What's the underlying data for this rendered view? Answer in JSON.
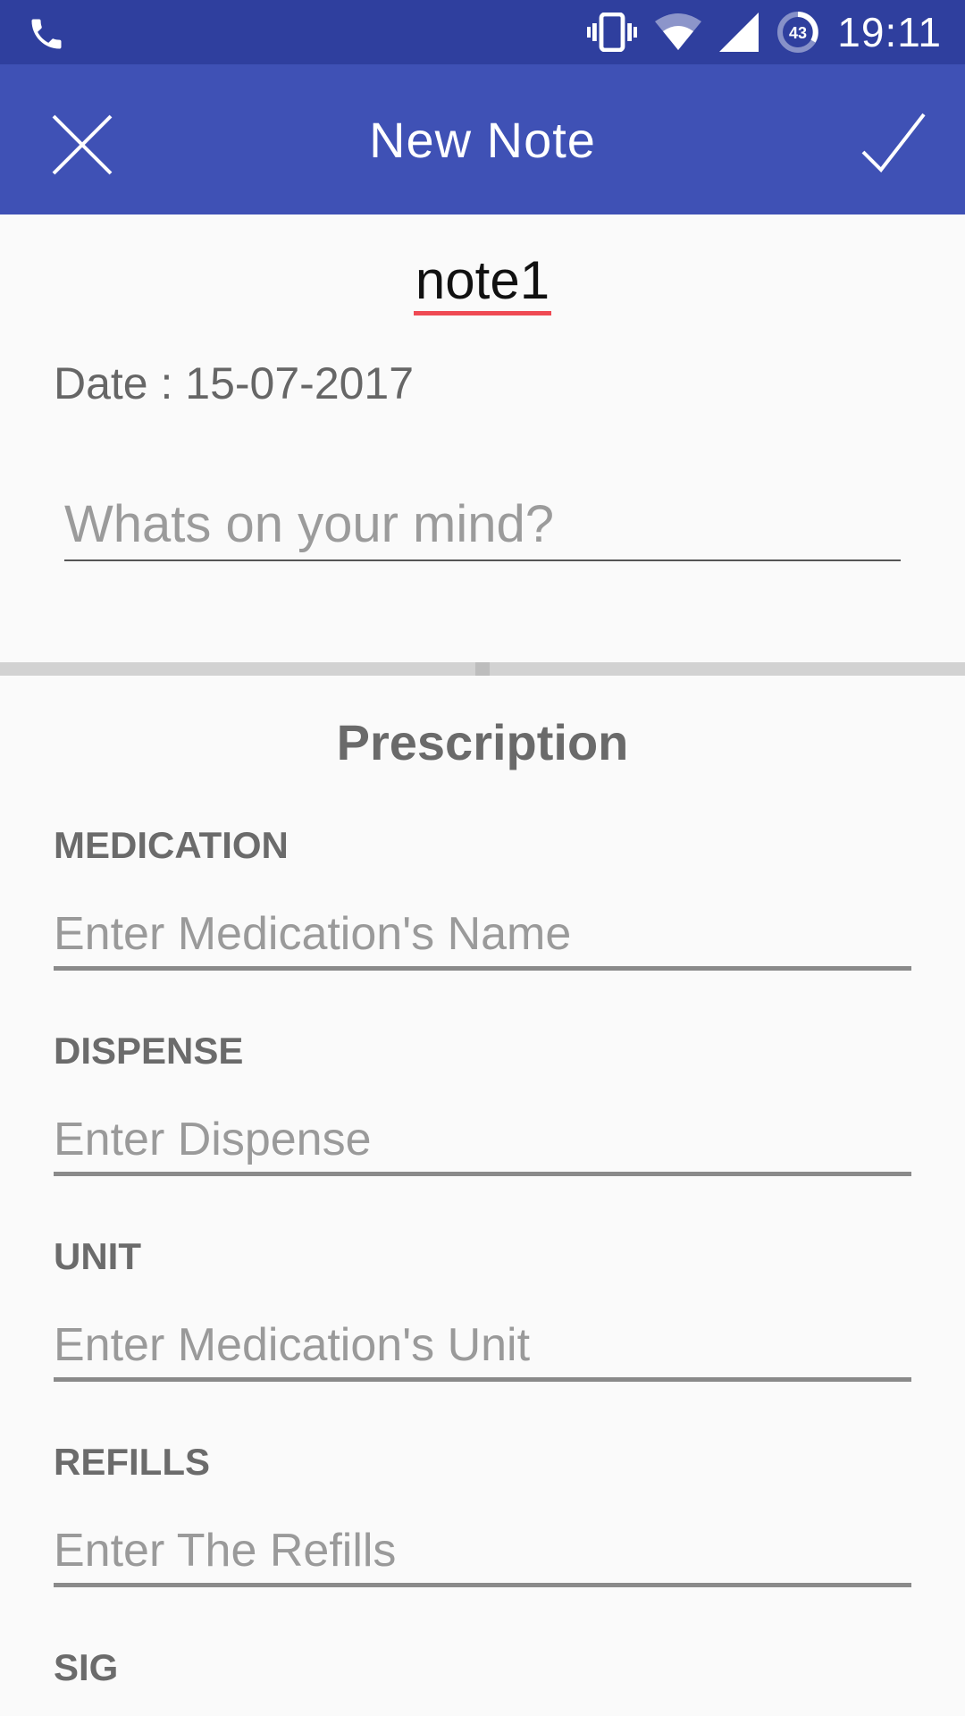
{
  "status_bar": {
    "time": "19:11",
    "battery_level": "43",
    "icons": [
      "phone-icon",
      "vibrate-icon",
      "wifi-icon",
      "signal-icon",
      "battery-icon"
    ]
  },
  "app_bar": {
    "title": "New Note",
    "close_icon": "close-icon",
    "save_icon": "check-icon",
    "color": "#3f51b5"
  },
  "note": {
    "title": "note1",
    "date_text": "Date : 15-07-2017",
    "body_placeholder": "Whats on your mind?"
  },
  "prescription": {
    "section_title": "Prescription",
    "fields": [
      {
        "label": "MEDICATION",
        "placeholder": "Enter Medication's Name"
      },
      {
        "label": "DISPENSE",
        "placeholder": "Enter Dispense"
      },
      {
        "label": "UNIT",
        "placeholder": "Enter Medication's Unit"
      },
      {
        "label": "REFILLS",
        "placeholder": "Enter The Refills"
      },
      {
        "label": "SIG"
      }
    ]
  }
}
